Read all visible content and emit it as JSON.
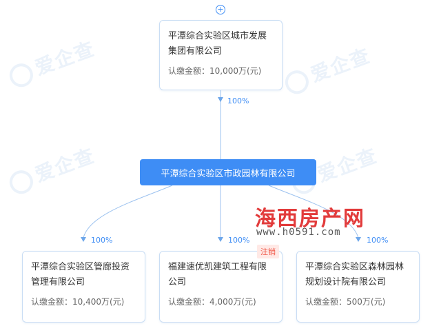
{
  "watermark": "爱企查",
  "root": {
    "name": "平潭综合实验区城市发展集团有限公司",
    "amount_label": "认缴金额：",
    "amount": "10,000万(元)"
  },
  "root_percent": "100%",
  "center_company": "平潭综合实验区市政园林有限公司",
  "children": [
    {
      "name": "平潭综合实验区管廊投资管理有限公司",
      "amount_label": "认缴金额：",
      "amount": "10,400万(元)",
      "percent": "100%"
    },
    {
      "name": "福建速优凯建筑工程有限公司",
      "amount_label": "认缴金额：",
      "amount": "4,000万(元)",
      "percent": "100%",
      "status": "注销"
    },
    {
      "name": "平潭综合实验区森林园林规划设计院有限公司",
      "amount_label": "认缴金额：",
      "amount": "500万(元)",
      "percent": "100%"
    }
  ],
  "site_watermark": {
    "name": "海西房产网",
    "url": "www.h0591.com"
  },
  "colors": {
    "primary": "#3e8df5",
    "line": "#9cc2ef",
    "card_border": "#c9ddf4",
    "badge_text": "#f05b4b"
  },
  "icons": {
    "expand": "plus-circle-icon",
    "arrow": "arrow-down-icon"
  }
}
